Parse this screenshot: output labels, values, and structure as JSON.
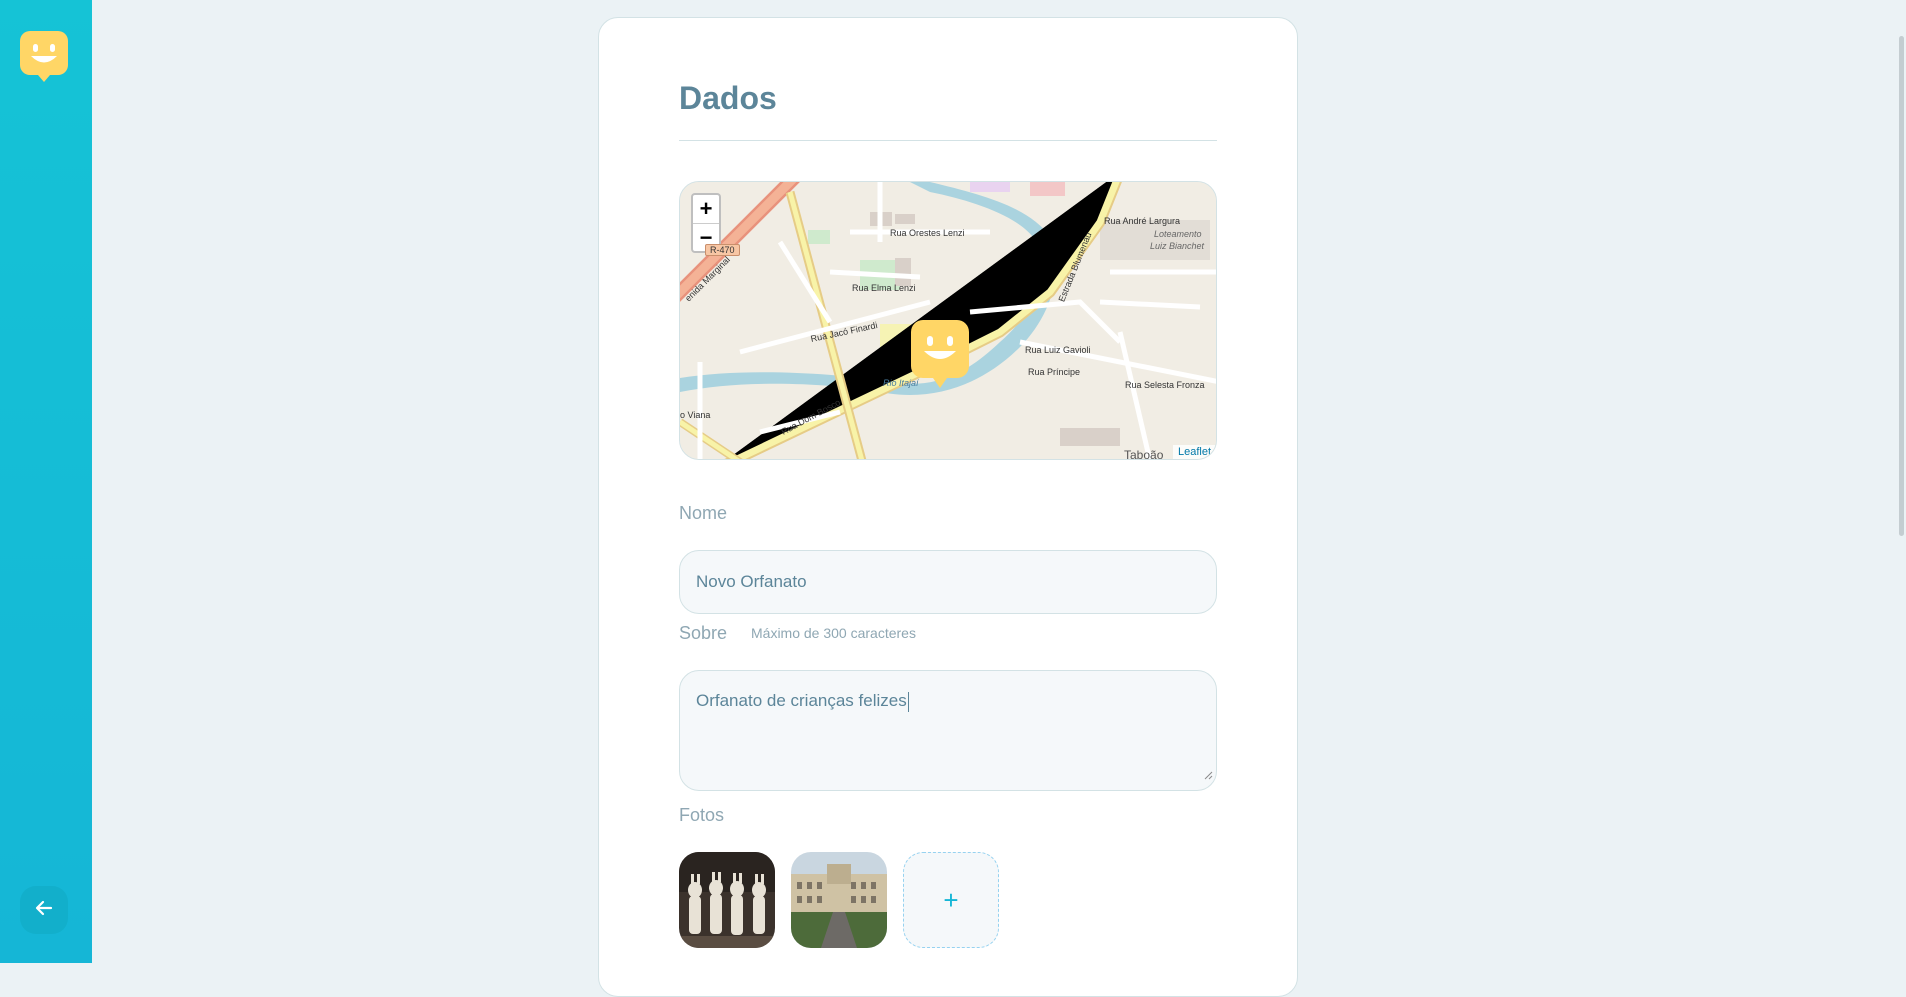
{
  "sidebar": {
    "logo_icon": "happy-face-icon",
    "back_icon": "arrow-left-icon"
  },
  "form": {
    "legend": "Dados",
    "map": {
      "zoom_in": "+",
      "zoom_out": "−",
      "attribution": "Leaflet",
      "labels": {
        "road_badge": "R-470",
        "rua_orestes": "Rua Orestes Lenzi",
        "rua_elma": "Rua Elma Lenzi",
        "rua_jaco": "Rua Jacó Finardi",
        "rua_andre": "Rua André Largura",
        "loteamento": "Loteamento",
        "luiz_bianchet": "Luiz Bianchet",
        "estrada": "Estrada Blumenau",
        "rua_luiz": "Rua Luiz Gavioli",
        "rua_principe": "Rua Príncipe",
        "rua_selesta": "Rua Selesta Fronza",
        "rio": "Rio Itajaí",
        "rua_dom_bosco": "Rua Dom Bosco",
        "viana": "o Viana",
        "marginal": "enida Marginal",
        "taboao": "Taboão"
      }
    },
    "name_label": "Nome",
    "name_value": "Novo Orfanato",
    "about_label": "Sobre",
    "about_hint": "Máximo de 300 caracteres",
    "about_value": "Orfanato de crianças felizes",
    "photos_label": "Fotos",
    "add_photo": "+"
  },
  "colors": {
    "sidebar": "#15c3d6",
    "accent": "#15b6d6",
    "title": "#5c8599",
    "marker": "#ffd666"
  }
}
